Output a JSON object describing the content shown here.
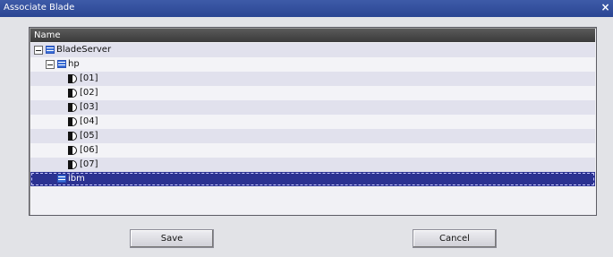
{
  "window": {
    "title": "Associate Blade",
    "close_glyph": "×"
  },
  "grid": {
    "column_header": "Name",
    "tree": [
      {
        "label": "BladeServer",
        "level": 0,
        "icon": "server-group-icon",
        "expanded": true
      },
      {
        "label": "hp",
        "level": 1,
        "icon": "chassis-icon",
        "expanded": true
      },
      {
        "label": "[01]",
        "level": 2,
        "icon": "blade-icon"
      },
      {
        "label": "[02]",
        "level": 2,
        "icon": "blade-icon"
      },
      {
        "label": "[03]",
        "level": 2,
        "icon": "blade-icon"
      },
      {
        "label": "[04]",
        "level": 2,
        "icon": "blade-icon"
      },
      {
        "label": "[05]",
        "level": 2,
        "icon": "blade-icon"
      },
      {
        "label": "[06]",
        "level": 2,
        "icon": "blade-icon"
      },
      {
        "label": "[07]",
        "level": 2,
        "icon": "blade-icon"
      },
      {
        "label": "ibm",
        "level": 1,
        "icon": "chassis-icon",
        "selected": true
      }
    ]
  },
  "buttons": {
    "save_label": "Save",
    "cancel_label": "Cancel"
  }
}
